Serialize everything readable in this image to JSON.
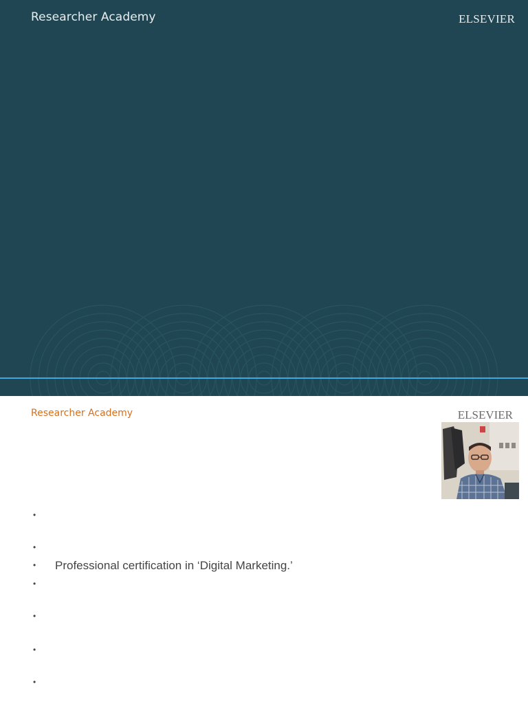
{
  "slide1": {
    "brand": "Researcher Academy",
    "publisher": "ELSEVIER",
    "background_color": "#1f4652",
    "accent_color": "#3fa9e0"
  },
  "slide2": {
    "brand": "Researcher Academy",
    "publisher": "ELSEVIER",
    "brand_color": "#d4711f",
    "bullets": [
      "",
      "",
      "Professional certification in ‘Digital Marketing.’",
      "",
      "",
      "",
      ""
    ]
  }
}
